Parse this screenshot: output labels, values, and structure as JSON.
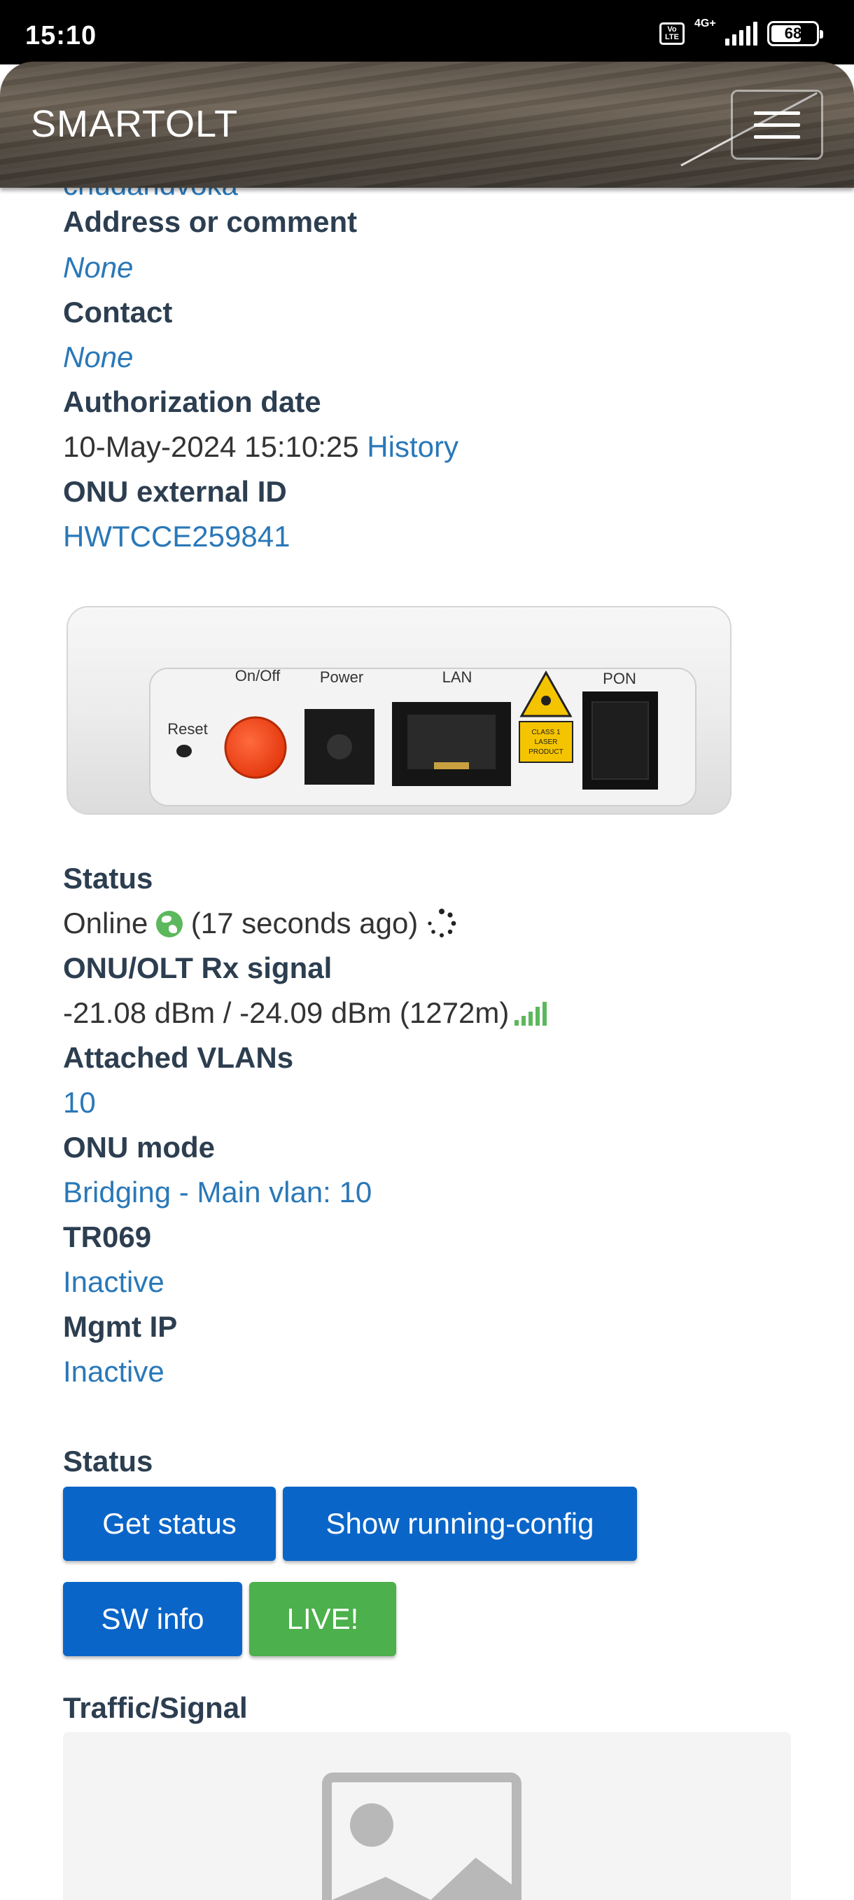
{
  "status_bar": {
    "time": "15:10",
    "network": "4G+",
    "volte": "Vo LTE",
    "battery": "68"
  },
  "navbar": {
    "brand": "SMARTOLT"
  },
  "details": {
    "clipped_value": "chudahdvoka",
    "address_label": "Address or comment",
    "address_value": "None",
    "contact_label": "Contact",
    "contact_value": "None",
    "auth_label": "Authorization date",
    "auth_value": "10-May-2024 15:10:25",
    "auth_history": "History",
    "ext_id_label": "ONU external ID",
    "ext_id_value": "HWTCCE259841"
  },
  "device_image": {
    "labels": {
      "reset": "Reset",
      "onoff": "On/Off",
      "power": "Power",
      "lan": "LAN",
      "pon": "PON",
      "laser1": "CLASS 1",
      "laser2": "LASER",
      "laser3": "PRODUCT"
    }
  },
  "status_info": {
    "status_label": "Status",
    "status_value": "Online",
    "status_time": "(17 seconds ago)",
    "signal_label": "ONU/OLT Rx signal",
    "signal_value": "-21.08 dBm / -24.09 dBm (1272m)",
    "vlans_label": "Attached VLANs",
    "vlans_value": "10",
    "mode_label": "ONU mode",
    "mode_value": "Bridging - Main vlan: 10",
    "tr069_label": "TR069",
    "tr069_value": "Inactive",
    "mgmt_label": "Mgmt IP",
    "mgmt_value": "Inactive"
  },
  "actions": {
    "section_label": "Status",
    "get_status": "Get status",
    "show_config": "Show running-config",
    "sw_info": "SW info",
    "live": "LIVE!"
  },
  "traffic": {
    "label": "Traffic/Signal"
  },
  "colors": {
    "link": "#2a78b8",
    "button_blue": "#0a65c8",
    "button_green": "#4cb04c",
    "online_green": "#5cb85c"
  }
}
